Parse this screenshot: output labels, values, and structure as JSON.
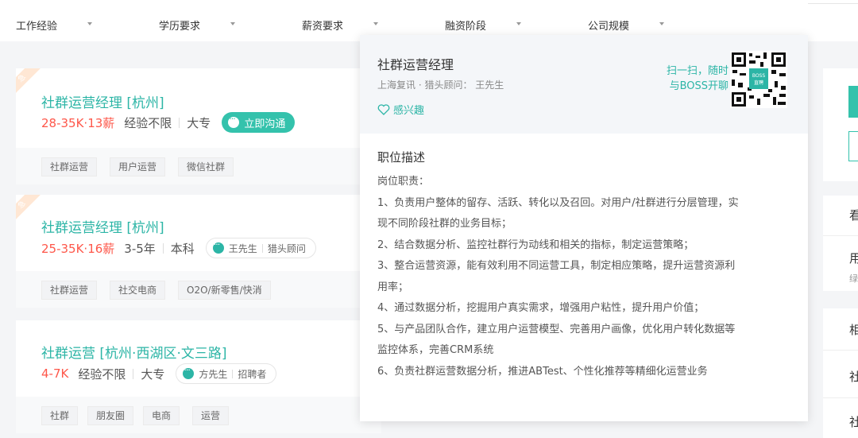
{
  "filters": [
    {
      "label": "工作经验"
    },
    {
      "label": "学历要求"
    },
    {
      "label": "薪资要求"
    },
    {
      "label": "融资阶段"
    },
    {
      "label": "公司规模"
    }
  ],
  "jobs": [
    {
      "title": "社群运营经理  [杭州]",
      "salary": "28-35K·13薪",
      "experience": "经验不限",
      "education": "大专",
      "chat_label": "立即沟通",
      "ribbon": "急",
      "tags": [
        "社群运营",
        "用户运营",
        "微信社群"
      ]
    },
    {
      "title": "社群运营经理  [杭州]",
      "salary": "25-35K·16薪",
      "experience": "3-5年",
      "education": "本科",
      "recruiter_name": "王先生",
      "recruiter_role": "猎头顾问",
      "ribbon": "急",
      "tags": [
        "社群运营",
        "社交电商",
        "O2O/新零售/快消"
      ]
    },
    {
      "title": "社群运营  [杭州·西湖区·文三路]",
      "salary": "4-7K",
      "experience": "经验不限",
      "education": "大专",
      "recruiter_name": "方先生",
      "recruiter_role": "招聘者",
      "tags": [
        "社群",
        "朋友圈",
        "电商",
        "运营"
      ]
    }
  ],
  "popover": {
    "title": "社群运营经理",
    "subtitle": "上海复讯 · 猎头顾问：  王先生",
    "interest": "感兴趣",
    "scan_line1": "扫一扫，随时",
    "scan_line2": "与BOSS开聊",
    "desc_title": "职位描述",
    "desc_lines": [
      "岗位职责：",
      "1、负责用户整体的留存、活跃、转化以及召回。对用户/社群进行分层管理，实",
      "现不同阶段社群的业务目标；",
      "2、结合数据分析、监控社群行为动线和相关的指标，制定运营策略；",
      "3、整合运营资源，能有效利用不同运营工具，制定相应策略，提升运营资源利",
      "用率；",
      "4、通过数据分析，挖掘用户真实需求，增强用户粘性，提升用户价值；",
      "5、与产品团队合作，建立用户运营模型、完善用户画像，优化用户转化数据等",
      "监控体系，完善CRM系统",
      "6、负责社群运营数据分析，推进ABTest、个性化推荐等精细化运营业务"
    ]
  },
  "sidebar": {
    "text1": "看",
    "text2": "用",
    "text3": "绿",
    "text4": "相",
    "text5": "社",
    "text6": "社"
  },
  "colors": {
    "accent": "#2cb5a6",
    "salary": "#fe574a"
  }
}
